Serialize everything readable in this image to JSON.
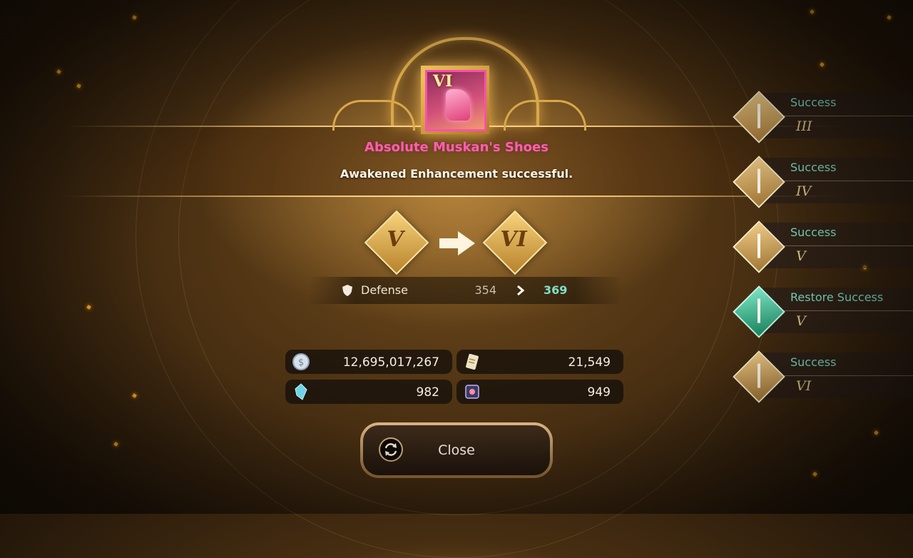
{
  "item": {
    "name": "Absolute Muskan's Shoes",
    "grade_badge": "VI"
  },
  "result_message": "Awakened Enhancement successful.",
  "grade_change": {
    "from": "V",
    "to": "VI"
  },
  "stat": {
    "label": "Defense",
    "old": "354",
    "new": "369",
    "icon": "shield-icon"
  },
  "currencies": [
    {
      "icon": "silver-coin-icon",
      "value": "12,695,017,267"
    },
    {
      "icon": "scroll-icon",
      "value": "21,549"
    },
    {
      "icon": "crystal-icon",
      "value": "982"
    },
    {
      "icon": "stone-icon",
      "value": "949"
    }
  ],
  "close_button": {
    "label": "Close",
    "icon": "refresh-icon"
  },
  "history": [
    {
      "status": "Success",
      "grade": "III",
      "icon": "sword-gold-icon"
    },
    {
      "status": "Success",
      "grade": "IV",
      "icon": "sword-gold-icon"
    },
    {
      "status": "Success",
      "grade": "V",
      "icon": "sword-gold-icon"
    },
    {
      "status": "Restore Success",
      "grade": "V",
      "icon": "sword-green-icon"
    },
    {
      "status": "Success",
      "grade": "VI",
      "icon": "sword-gold-icon"
    }
  ],
  "colors": {
    "item_name": "#ff5fb0",
    "success_text": "#7fe0c8",
    "gold": "#d9a84a"
  }
}
